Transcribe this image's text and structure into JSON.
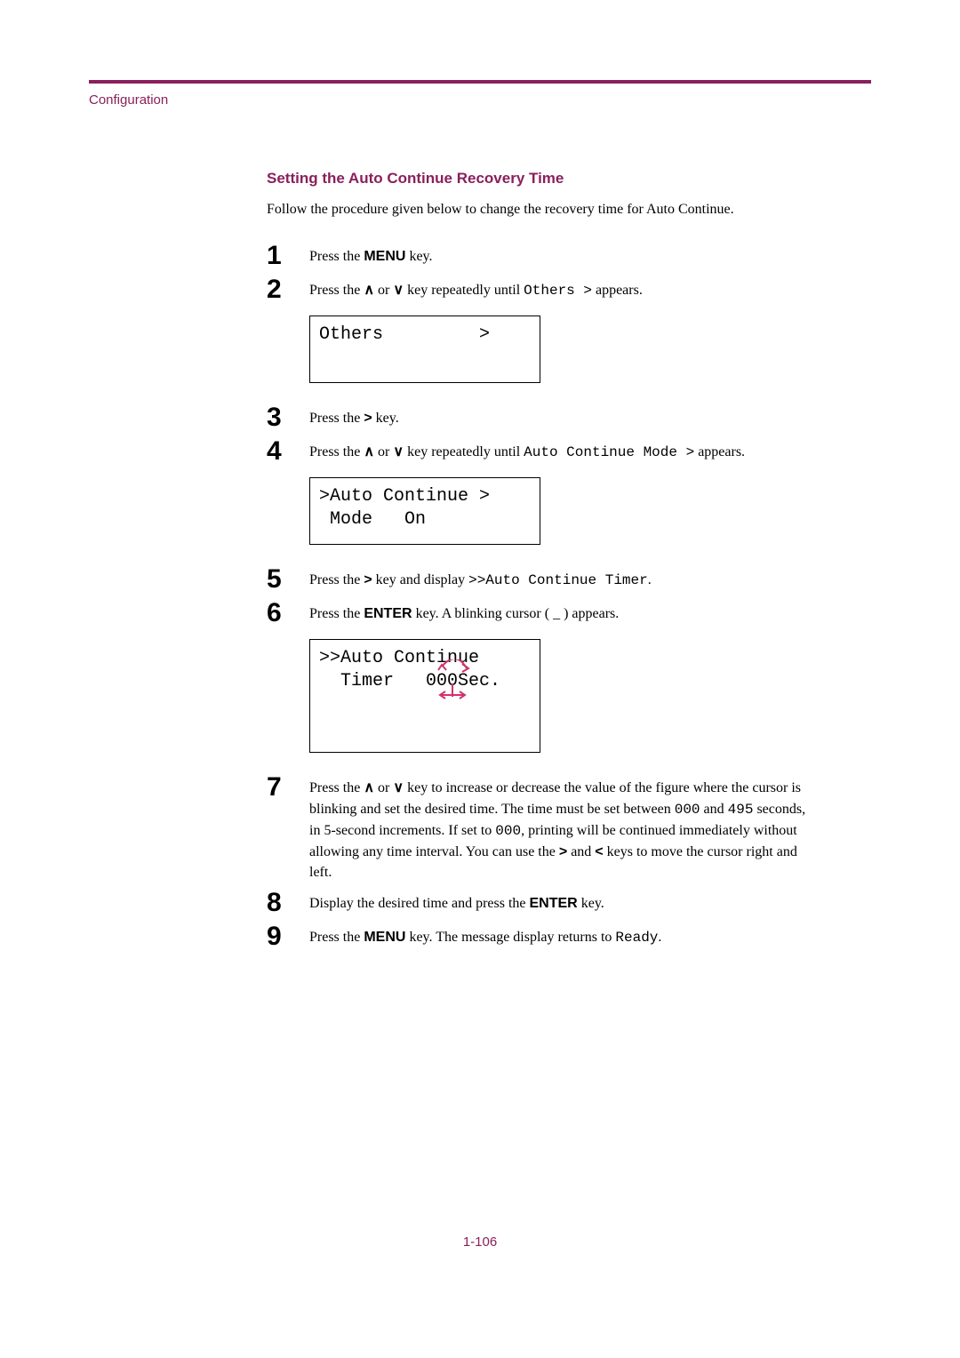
{
  "section_label": "Configuration",
  "heading": "Setting the Auto Continue Recovery Time",
  "intro": "Follow the procedure given below to change the recovery time for Auto Continue.",
  "steps": {
    "s1": {
      "num": "1",
      "p1": "Press the ",
      "key": "MENU",
      "p2": " key."
    },
    "s2": {
      "num": "2",
      "p1": "Press the ",
      "up": "∧",
      "or": " or ",
      "down": "∨",
      "p2": " key repeatedly until ",
      "mono": "Others >",
      "p3": " appears."
    },
    "lcd1": {
      "line1": "Others         >"
    },
    "s3": {
      "num": "3",
      "p1": "Press the ",
      "key": ">",
      "p2": " key."
    },
    "s4": {
      "num": "4",
      "p1": "Press the ",
      "up": "∧",
      "or": " or ",
      "down": "∨",
      "p2": " key repeatedly until ",
      "mono": "Auto Continue Mode >",
      "p3": " appears."
    },
    "lcd2": {
      "line1": ">Auto Continue >",
      "line2": " Mode   On"
    },
    "s5": {
      "num": "5",
      "p1": "Press the ",
      "key": ">",
      "p2": " key and display ",
      "mono": ">>Auto Continue Timer",
      "p3": "."
    },
    "s6": {
      "num": "6",
      "p1": "Press the ",
      "key": "ENTER",
      "p2": " key. A blinking cursor ( _ ) appears."
    },
    "lcd3": {
      "line1": ">>Auto Continue",
      "line2": "  Timer   000Sec."
    },
    "s7": {
      "num": "7",
      "p1": "Press the ",
      "up": "∧",
      "or": " or ",
      "down": "∨",
      "p2": " key to increase or decrease the value of the figure where the cursor is blinking and set the desired time. The time must be set between ",
      "mono1": "000",
      "p3": " and ",
      "mono2": "495",
      "p4": " seconds, in 5-second increments. If set to ",
      "mono3": "000",
      "p5": ", printing will be continued immediately without allowing any time interval. You can use the ",
      "gt": ">",
      "p6": " and ",
      "lt": "<",
      "p7": " keys to move the cursor right and left."
    },
    "s8": {
      "num": "8",
      "p1": "Display the desired time and press the ",
      "key": "ENTER",
      "p2": " key."
    },
    "s9": {
      "num": "9",
      "p1": "Press the ",
      "key": "MENU",
      "p2": " key. The message display returns to ",
      "mono": "Ready",
      "p3": "."
    }
  },
  "page_number": "1-106"
}
